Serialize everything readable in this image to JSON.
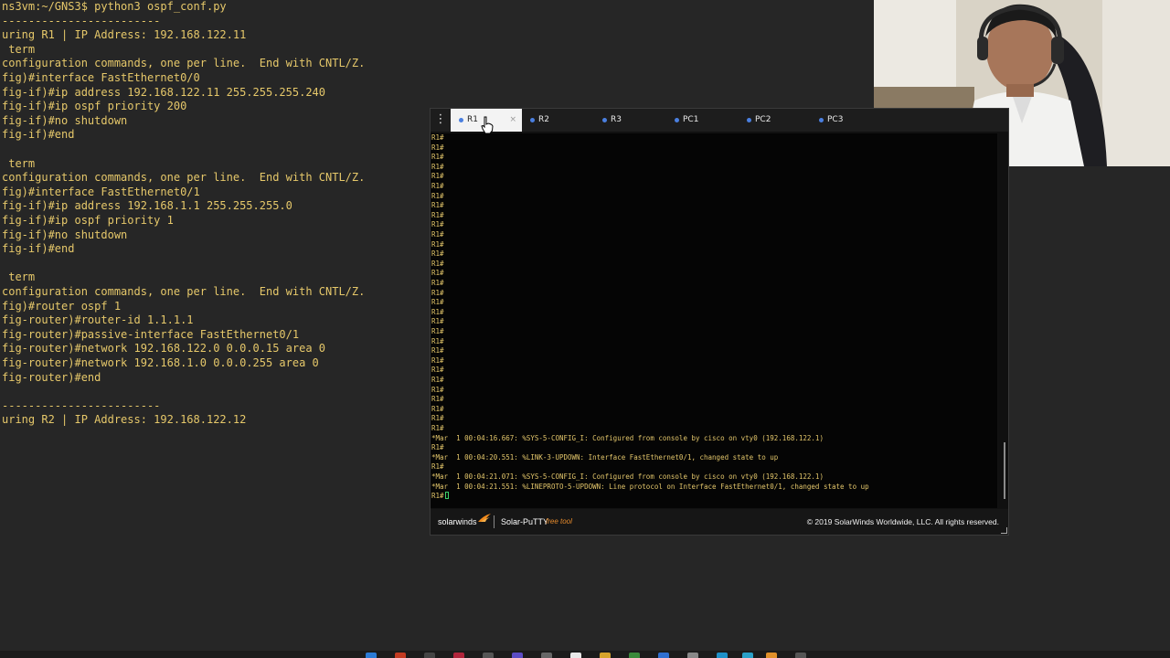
{
  "terminal": {
    "lines": [
      "ns3vm:~/GNS3$ python3 ospf_conf.py",
      "------------------------",
      "uring R1 | IP Address: 192.168.122.11",
      " term",
      "configuration commands, one per line.  End with CNTL/Z.",
      "fig)#interface FastEthernet0/0",
      "fig-if)#ip address 192.168.122.11 255.255.255.240",
      "fig-if)#ip ospf priority 200",
      "fig-if)#no shutdown",
      "fig-if)#end",
      "",
      " term",
      "configuration commands, one per line.  End with CNTL/Z.",
      "fig)#interface FastEthernet0/1",
      "fig-if)#ip address 192.168.1.1 255.255.255.0",
      "fig-if)#ip ospf priority 1",
      "fig-if)#no shutdown",
      "fig-if)#end",
      "",
      " term",
      "configuration commands, one per line.  End with CNTL/Z.",
      "fig)#router ospf 1",
      "fig-router)#router-id 1.1.1.1",
      "fig-router)#passive-interface FastEthernet0/1",
      "fig-router)#network 192.168.122.0 0.0.0.15 area 0",
      "fig-router)#network 192.168.1.0 0.0.0.255 area 0",
      "fig-router)#end",
      "",
      "------------------------",
      "uring R2 | IP Address: 192.168.122.12"
    ]
  },
  "putty": {
    "menu_icon": "⋮",
    "tabs": [
      {
        "label": "R1",
        "active": true
      },
      {
        "label": "R2",
        "active": false
      },
      {
        "label": "R3",
        "active": false
      },
      {
        "label": "PC1",
        "active": false
      },
      {
        "label": "PC2",
        "active": false
      },
      {
        "label": "PC3",
        "active": false
      }
    ],
    "tab_close": "×",
    "console_lines": [
      "R1#",
      "R1#",
      "R1#",
      "R1#",
      "R1#",
      "R1#",
      "R1#",
      "R1#",
      "R1#",
      "R1#",
      "R1#",
      "R1#",
      "R1#",
      "R1#",
      "R1#",
      "R1#",
      "R1#",
      "R1#",
      "R1#",
      "R1#",
      "R1#",
      "R1#",
      "R1#",
      "R1#",
      "R1#",
      "R1#",
      "R1#",
      "R1#",
      "R1#",
      "R1#",
      "R1#",
      "*Mar  1 00:04:16.667: %SYS-5-CONFIG_I: Configured from console by cisco on vty0 (192.168.122.1)",
      "R1#",
      "*Mar  1 00:04:20.551: %LINK-3-UPDOWN: Interface FastEthernet0/1, changed state to up",
      "R1#",
      "*Mar  1 00:04:21.071: %SYS-5-CONFIG_I: Configured from console by cisco on vty0 (192.168.122.1)",
      "*Mar  1 00:04:21.551: %LINEPROTO-5-UPDOWN: Line protocol on Interface FastEthernet0/1, changed state to up",
      "R1#"
    ],
    "footer": {
      "logo": "solarwinds",
      "product": "Solar-PuTTY",
      "tag": "free tool",
      "copyright": "© 2019 SolarWinds Worldwide, LLC. All rights reserved."
    }
  },
  "colors": {
    "terminal_text": "#e6c86a",
    "console_text": "#e2c56a",
    "tab_dot": "#4a7fe0",
    "cursor": "#3cd26a"
  }
}
